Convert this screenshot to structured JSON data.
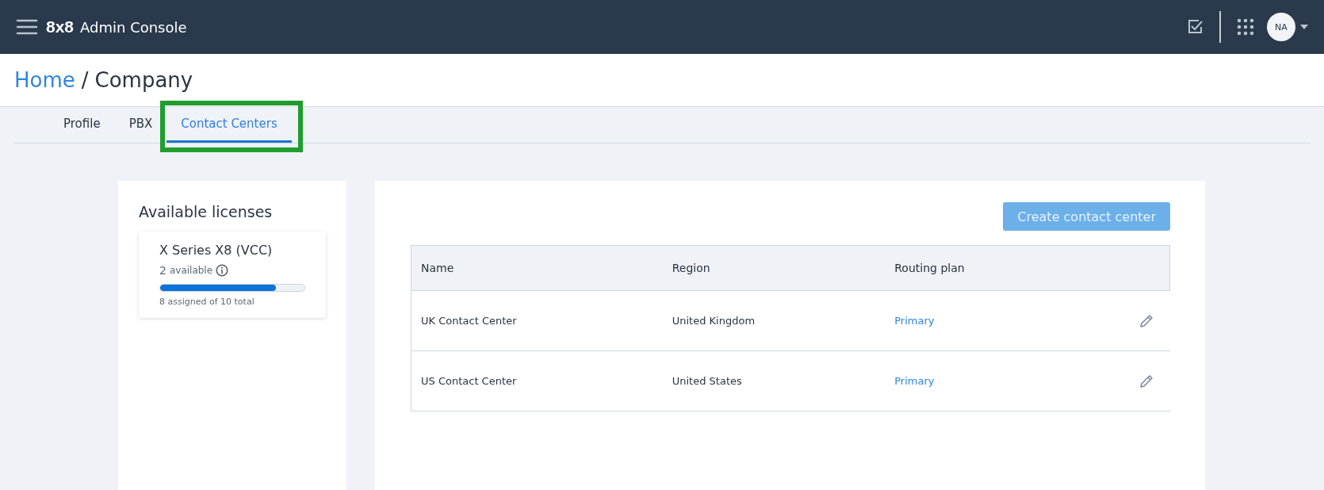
{
  "app_bar": {
    "logo": "8x8",
    "title": "Admin Console",
    "avatar": "NA"
  },
  "breadcrumb": {
    "home": "Home",
    "separator": "/",
    "current": "Company"
  },
  "tabs": [
    {
      "label": "Profile",
      "selected": false
    },
    {
      "label": "PBX",
      "selected": false
    },
    {
      "label": "Contact Centers",
      "selected": true
    }
  ],
  "licenses": {
    "title": "Available licenses",
    "items": [
      {
        "name": "X Series X8 (VCC)",
        "count": "2",
        "available": "available",
        "level": 0.8,
        "summary": "8 assigned of 10 total"
      }
    ]
  },
  "create_button": {
    "label": "Create contact center",
    "disabled": true
  },
  "table": {
    "columns": [
      "Name",
      "Region",
      "Routing plan"
    ],
    "rows": [
      {
        "name": "UK Contact Center",
        "region": "United Kingdom",
        "routing_plan": "Primary"
      },
      {
        "name": "US Contact Center",
        "region": "United States",
        "routing_plan": "Primary"
      }
    ]
  }
}
